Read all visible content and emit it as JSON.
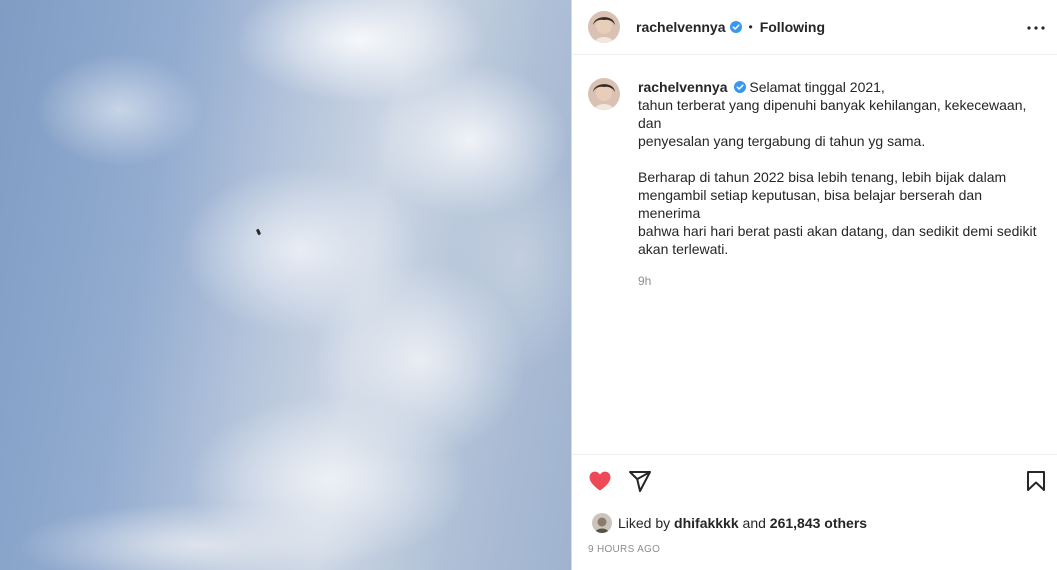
{
  "post": {
    "username": "rachelvennya",
    "follow_separator": "•",
    "follow_status": "Following",
    "caption": {
      "lines": [
        "Selamat tinggal 2021,",
        "tahun terberat yang dipenuhi banyak kehilangan, kekecewaan, dan",
        "penyesalan yang tergabung di tahun yg sama.",
        "",
        "Berharap di tahun 2022 bisa lebih tenang, lebih bijak dalam",
        "mengambil setiap keputusan, bisa belajar berserah dan menerima",
        "bahwa hari hari berat pasti akan datang, dan sedikit demi sedikit",
        "akan terlewati."
      ],
      "relative_time": "9h"
    },
    "likes": {
      "prefix": "Liked by",
      "liker": "dhifakkkk",
      "joiner": "and",
      "count": "261,843 others"
    },
    "timestamp": "9 HOURS AGO"
  },
  "icons": {
    "verified": "verified-badge-icon",
    "more": "more-options-icon",
    "like": "heart-icon",
    "share": "paper-plane-icon",
    "save": "bookmark-icon"
  },
  "colors": {
    "like_red": "#ed4956",
    "verified_blue": "#3897f0",
    "secondary_text": "#8e8e8e",
    "divider": "#efefef"
  }
}
